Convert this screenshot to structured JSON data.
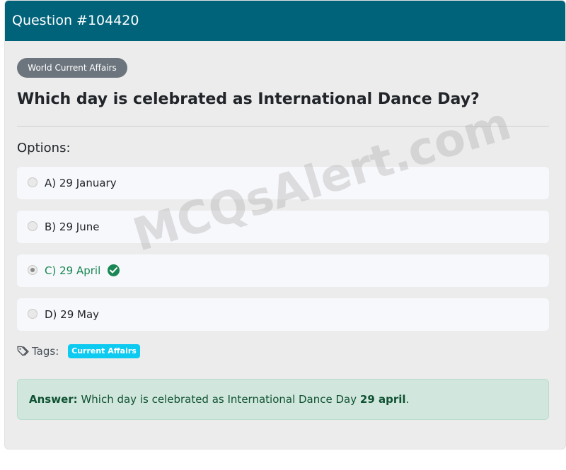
{
  "header": {
    "title": "Question #104420"
  },
  "category": {
    "label": "World Current Affairs"
  },
  "question": {
    "text": "Which day is celebrated as International Dance Day?"
  },
  "options_label": "Options:",
  "options": [
    {
      "label": "A) 29 January",
      "selected": false,
      "correct": false
    },
    {
      "label": "B) 29 June",
      "selected": false,
      "correct": false
    },
    {
      "label": "C) 29 April",
      "selected": true,
      "correct": true
    },
    {
      "label": "D) 29 May",
      "selected": false,
      "correct": false
    }
  ],
  "tags": {
    "label": "Tags:",
    "items": [
      "Current Affairs"
    ]
  },
  "answer": {
    "prefix": "Answer:",
    "text": "Which day is celebrated as International Dance Day",
    "highlight": "29 april",
    "suffix": "."
  },
  "watermark": "MCQsAlert.com",
  "colors": {
    "header_bg": "#00637a",
    "correct": "#198754",
    "tag_badge": "#0dcaf0",
    "category_badge": "#6c757d",
    "answer_bg": "#d1e7dd"
  },
  "icons": [
    "check-circle-icon",
    "tag-icon",
    "radio-icon"
  ]
}
